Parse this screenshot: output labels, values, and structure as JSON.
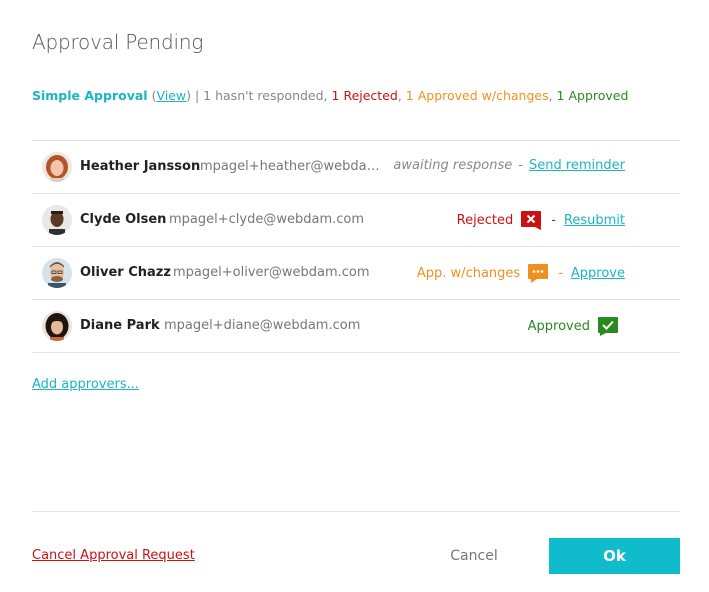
{
  "dialog": {
    "title": "Approval Pending"
  },
  "summary": {
    "workflow_name": "Simple Approval",
    "open_paren": "(",
    "view_label": "View",
    "close_sep": ") | ",
    "not_responded": "1 hasn't responded, ",
    "rejected": "1 Rejected",
    "comma1": ", ",
    "approved_changes": "1 Approved w/changes",
    "comma2": ", ",
    "approved": "1 Approved"
  },
  "approvers": [
    {
      "name": "Heather Jansson",
      "email": "mpagel+heather@webdam.com",
      "status": "awaiting response",
      "separator": "-",
      "action": "Send reminder",
      "status_color": "#888888"
    },
    {
      "name": "Clyde Olsen",
      "email": "mpagel+clyde@webdam.com",
      "status": "Rejected",
      "status_icon": "x-icon",
      "separator": "-",
      "action": "Resubmit",
      "status_color": "#cc1111"
    },
    {
      "name": "Oliver Chazz",
      "email": "mpagel+oliver@webdam.com",
      "status": "App. w/changes",
      "status_icon": "comment-icon",
      "separator": "-",
      "action": "Approve",
      "status_color": "#f0901e"
    },
    {
      "name": "Diane Park",
      "email": "mpagel+diane@webdam.com",
      "status": "Approved",
      "status_icon": "check-icon",
      "status_color": "#2a8a1f"
    }
  ],
  "add_approvers_label": "Add approvers...",
  "footer": {
    "cancel_request_label": "Cancel Approval Request",
    "cancel_label": "Cancel",
    "ok_label": "Ok"
  },
  "colors": {
    "accent": "#1bb5c4",
    "ok_button": "#10bccb",
    "rejected": "#cc1111",
    "changes": "#f0901e",
    "approved": "#2a8a1f"
  }
}
